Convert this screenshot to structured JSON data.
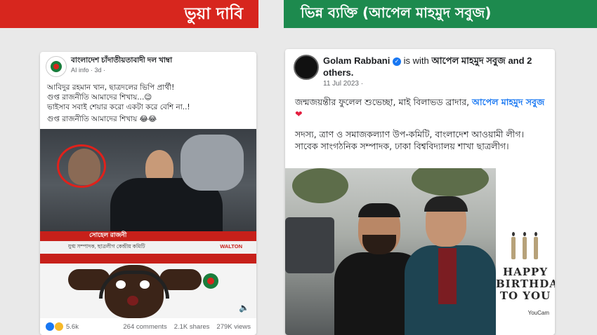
{
  "banners": {
    "fake_claim": "ভুয়া দাবি",
    "real_person": "ভিন্ন ব্যক্তি (আপেল মাহমুদ সবুজ)"
  },
  "left_post": {
    "page_name": "বাংলাদেশ চাঁদাতীয়তাবাদী দল খাম্বা",
    "meta": "AI info · 3d ·",
    "text_lines": [
      "আবিদুর রহমান খান, ছাত্রদলের ভিপি প্রার্থী!",
      "গুপ্ত রাজনীতি আমাদের শিখায়...😉",
      "ভাইসাব সবাই শেয়ার করো একটা করে বেশি না..!"
    ],
    "quoted_line": "গুপ্ত রাজনীতি আমাদের শিখায় 😂😂",
    "tv_name": "সোহেল রাজনী",
    "tv_caption": "যুগ্ম সম্পাদক, ছাত্রলীগ কেন্দ্রীয় কমিটি",
    "tv_channel": "WALTON",
    "stats": {
      "reactions": "5.6k",
      "comments": "264 comments",
      "shares": "2.1K shares",
      "views": "279K views"
    }
  },
  "right_post": {
    "author": "Golam Rabbani",
    "verified_icon": "verified-badge",
    "is_with": "is with",
    "tagged": "আপেল মাহমুদ সবুজ",
    "and_others": "and 2 others.",
    "date": "11 Jul 2023 ·",
    "line1_prefix": "জন্মজয়ন্তীর ফুলেল শুভেচ্ছা, মাই বিলাভড ব্রাদার, ",
    "line1_link": "আপেল মাহমুদ সবুজ",
    "heart": "❤",
    "paragraph2": "সদস্য, ত্রাণ ও সমাজকল্যাণ উপ-কমিটি, বাংলাদেশ আওয়ামী লীগ। সাবেক সাংগঠনিক সম্পাদক, ঢাকা বিশ্ববিদ্যালয় শাখা ছাত্রলীগ।",
    "bday_text": "HAPPY BIRTHDAY TO YOU",
    "youcam": "YouCam"
  },
  "colors": {
    "fake_banner": "#d7261e",
    "real_banner": "#1d8a4e",
    "link": "#1877f2"
  }
}
